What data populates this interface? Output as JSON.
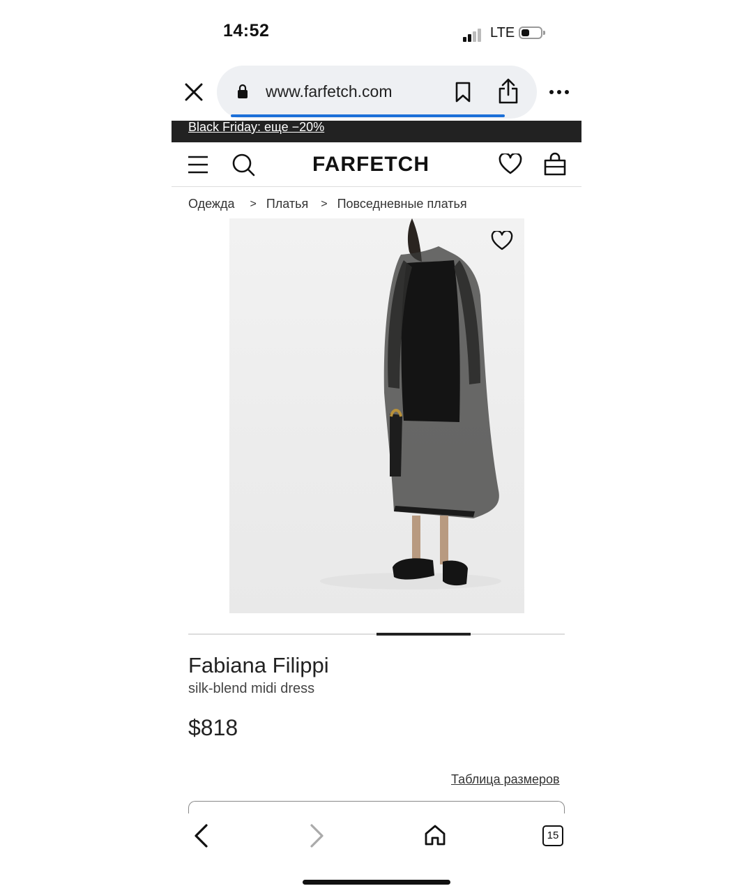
{
  "status_bar": {
    "time": "14:52",
    "network": "LTE"
  },
  "browser": {
    "url": "www.farfetch.com",
    "icons": [
      "close-icon",
      "lock-icon",
      "bookmark-icon",
      "share-icon",
      "more-icon"
    ]
  },
  "promo": {
    "text": "Black Friday: еще −20%"
  },
  "header": {
    "logo": "FARFETCH",
    "icons": [
      "menu-icon",
      "search-icon",
      "heart-icon",
      "bag-icon"
    ]
  },
  "breadcrumb": {
    "items": [
      "Одежда",
      "Платья",
      "Повседневные платья"
    ],
    "separator": ">"
  },
  "product": {
    "brand": "Fabiana Filippi",
    "name": "silk-blend midi dress",
    "price": "$818",
    "size_guide": "Таблица размеров"
  },
  "toolbar": {
    "tab_count": "15"
  },
  "colors": {
    "promo_bg": "#222222",
    "progress": "#1b6fd8",
    "url_bar": "#eef0f3"
  }
}
